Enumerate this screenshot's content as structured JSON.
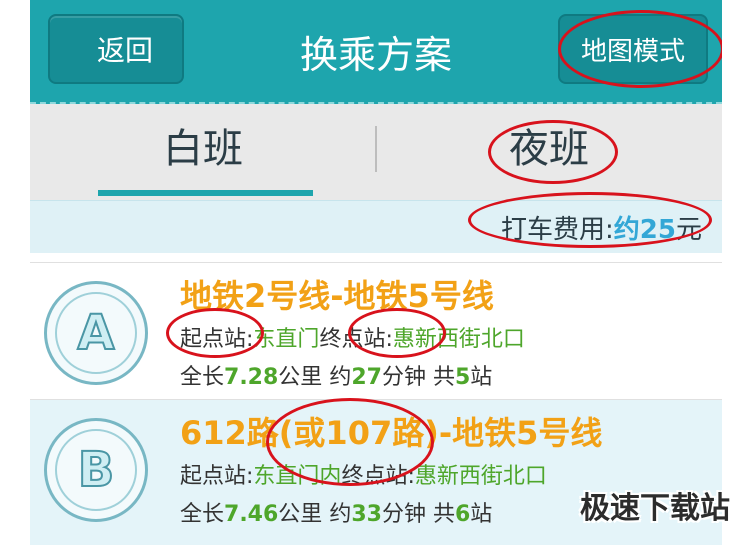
{
  "header": {
    "back_label": "返回",
    "title": "换乘方案",
    "map_mode_label": "地图模式"
  },
  "tabs": [
    {
      "label": "白班",
      "active": true
    },
    {
      "label": "夜班",
      "active": false
    }
  ],
  "fare": {
    "label": "打车费用:",
    "approx": "约",
    "amount": "25",
    "unit": "元"
  },
  "routes": [
    {
      "badge": "A",
      "name": "地铁2号线-地铁5号线",
      "start_label": "起点站:",
      "start": "东直门",
      "end_label": "终点站:",
      "end": "惠新西街北口",
      "length_prefix": "全长",
      "length": "7.28",
      "length_unit": "公里",
      "time_prefix": "约",
      "time": "27",
      "time_unit": "分钟",
      "stops_prefix": "共",
      "stops": "5",
      "stops_unit": "站"
    },
    {
      "badge": "B",
      "name": "612路(或107路)-地铁5号线",
      "start_label": "起点站:",
      "start": "东直门内",
      "end_label": "终点站:",
      "end": "惠新西街北口",
      "length_prefix": "全长",
      "length": "7.46",
      "length_unit": "公里",
      "time_prefix": "约",
      "time": "33",
      "time_unit": "分钟",
      "stops_prefix": "共",
      "stops": "6",
      "stops_unit": "站"
    }
  ],
  "watermark": "极速下载站",
  "colors": {
    "header": "#1ea5ad",
    "route_title": "#f2a116",
    "station": "#4ea62b",
    "fare_amount": "#33a7d6",
    "annotation": "#d8121c"
  }
}
